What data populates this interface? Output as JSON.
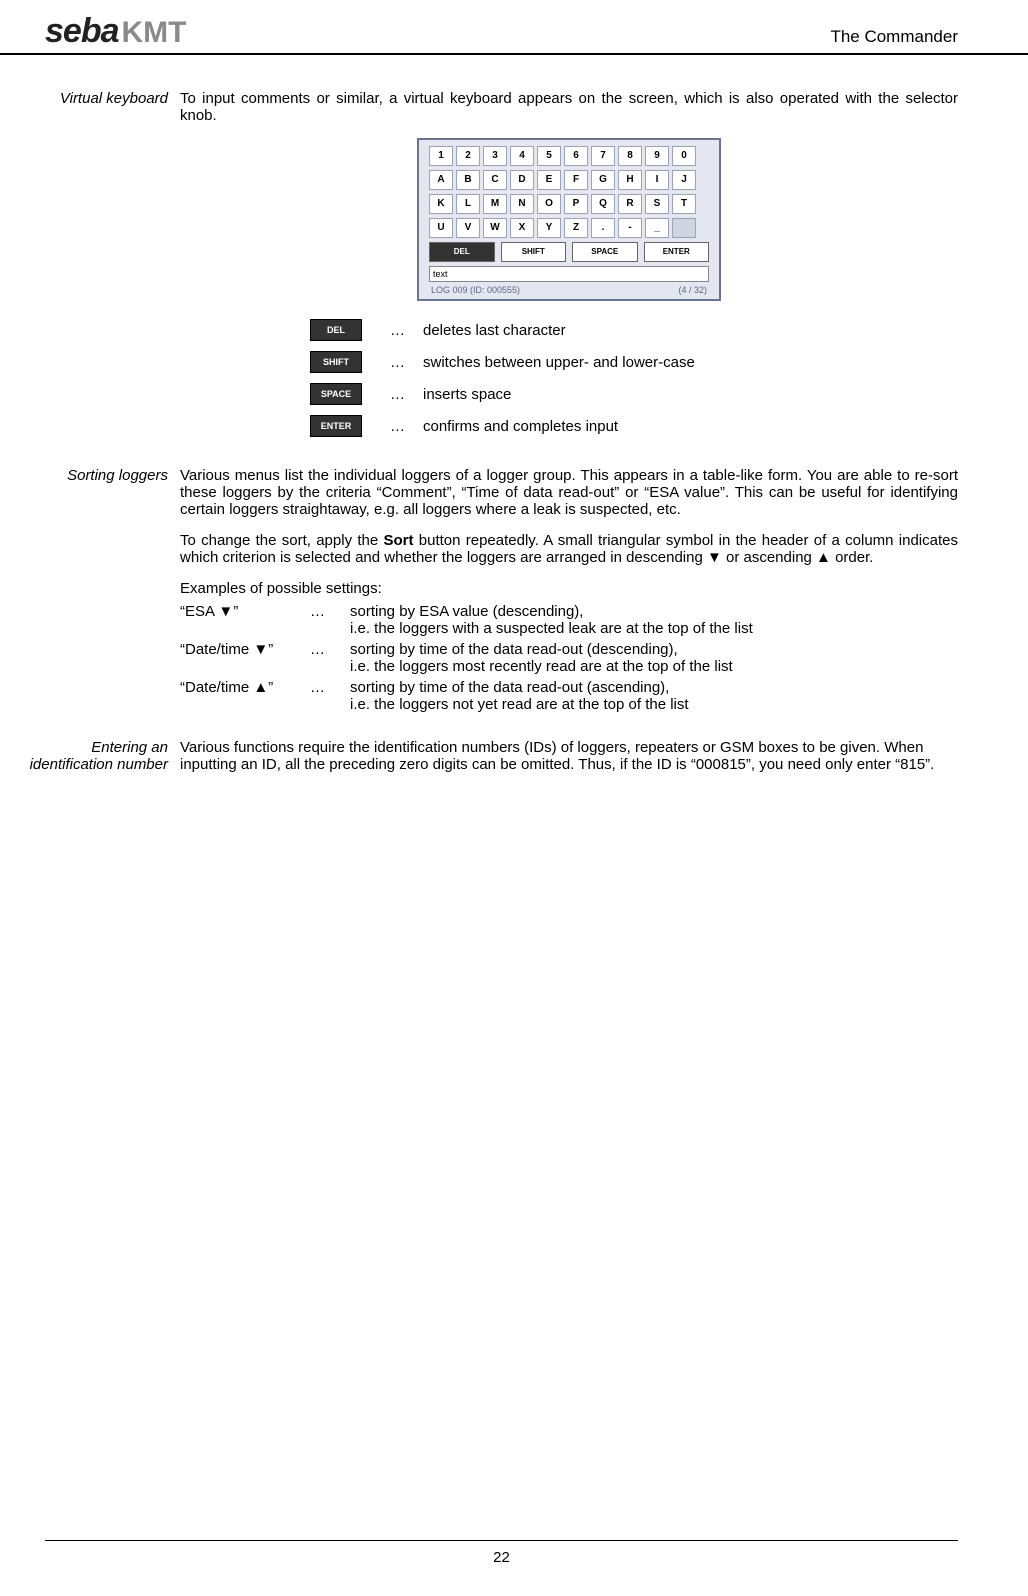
{
  "header": {
    "logo_part1": "seba",
    "logo_part2": "KMT",
    "title": "The Commander"
  },
  "section_vk": {
    "label": "Virtual keyboard",
    "intro": "To input comments or similar, a virtual keyboard appears on the screen, which is also operated with the selector knob.",
    "keyboard": {
      "row1": [
        "1",
        "2",
        "3",
        "4",
        "5",
        "6",
        "7",
        "8",
        "9",
        "0"
      ],
      "row2": [
        "A",
        "B",
        "C",
        "D",
        "E",
        "F",
        "G",
        "H",
        "I",
        "J"
      ],
      "row3": [
        "K",
        "L",
        "M",
        "N",
        "O",
        "P",
        "Q",
        "R",
        "S",
        "T"
      ],
      "row4": [
        "U",
        "V",
        "W",
        "X",
        "Y",
        "Z",
        ".",
        "-",
        "_",
        ""
      ],
      "btns": {
        "del": "DEL",
        "shift": "SHIFT",
        "space": "SPACE",
        "enter": "ENTER"
      },
      "input_text": "text",
      "status_left": "LOG 009 (ID: 000555)",
      "status_right": "(4 / 32)"
    },
    "key_desc": [
      {
        "btn": "DEL",
        "ell": "…",
        "text": "deletes last character"
      },
      {
        "btn": "SHIFT",
        "ell": "…",
        "text": "switches between upper- and lower-case"
      },
      {
        "btn": "SPACE",
        "ell": "…",
        "text": "inserts space"
      },
      {
        "btn": "ENTER",
        "ell": "…",
        "text": "confirms and completes input"
      }
    ]
  },
  "section_sort": {
    "label": "Sorting loggers",
    "p1": "Various menus list the individual loggers of a logger group. This appears in a table-like form. You are able to re-sort these loggers by the criteria “Comment”, “Time of data read-out” or “ESA value”. This can be useful for identifying certain loggers straightaway, e.g. all loggers where a leak is suspected, etc.",
    "p2_pre": "To change the sort, apply the ",
    "p2_bold": "Sort",
    "p2_post": " button repeatedly. A small triangular symbol in the header of a column indicates which criterion is selected and whether the loggers are arranged in descending ▼ or ascending ▲ order.",
    "examples_title": "Examples of possible settings:",
    "examples": [
      {
        "label": "“ESA ▼”",
        "ell": "…",
        "line1": "sorting by ESA value (descending),",
        "line2": "i.e. the loggers with a suspected leak are at the top of the list"
      },
      {
        "label": "“Date/time ▼”",
        "ell": "…",
        "line1": "sorting by time of the data read-out (descending),",
        "line2": "i.e. the loggers most recently read are at the top of the list"
      },
      {
        "label": "“Date/time ▲”",
        "ell": "…",
        "line1": "sorting by time of the data read-out (ascending),",
        "line2": "i.e. the loggers not yet read are at the top of the list"
      }
    ]
  },
  "section_id": {
    "label_l1": "Entering an",
    "label_l2": "identification number",
    "text": "Various functions require the identification numbers (IDs) of loggers, repeaters or GSM boxes to be given. When inputting an ID, all the preceding zero digits can be omitted. Thus, if the ID is “000815”, you need only enter “815”."
  },
  "footer": {
    "page": "22"
  }
}
